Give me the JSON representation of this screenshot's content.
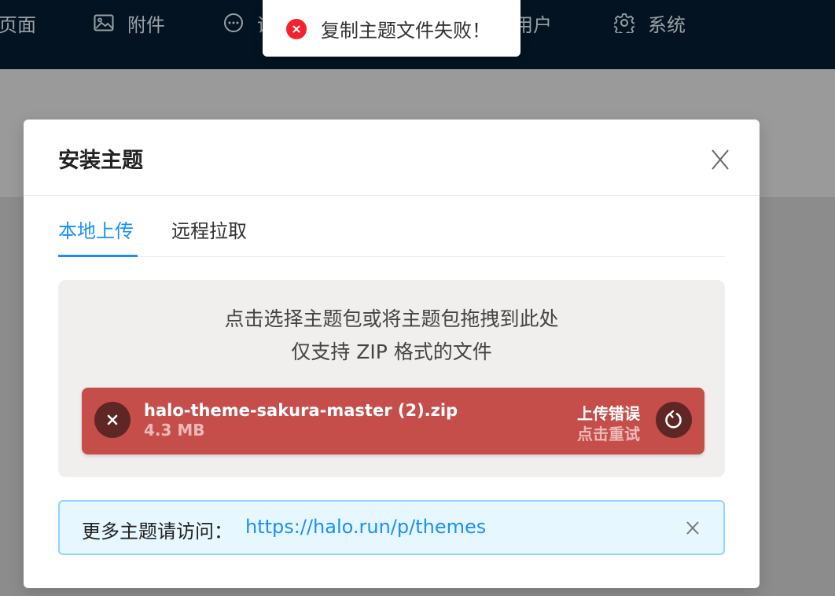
{
  "nav": {
    "items": [
      {
        "label": "页面",
        "icon": "page-icon"
      },
      {
        "label": "附件",
        "icon": "image-icon"
      },
      {
        "label": "评论",
        "icon": "comment-icon"
      },
      {
        "label": "用户",
        "icon": "user-icon"
      },
      {
        "label": "系统",
        "icon": "gear-icon"
      }
    ]
  },
  "toast": {
    "message": "复制主题文件失败！",
    "icon": "error-circle-icon",
    "color": "#f5222d"
  },
  "modal": {
    "title": "安装主题",
    "close_icon": "close-icon",
    "tabs": [
      {
        "label": "本地上传",
        "active": true
      },
      {
        "label": "远程拉取",
        "active": false
      }
    ],
    "dropzone": {
      "line1": "点击选择主题包或将主题包拖拽到此处",
      "line2": "仅支持 ZIP 格式的文件"
    },
    "file": {
      "name": "halo-theme-sakura-master (2).zip",
      "size": "4.3 MB",
      "status": "上传错误",
      "action": "点击重试",
      "color": "#c54e4b"
    },
    "info": {
      "label": "更多主题请访问：",
      "link": "https://halo.run/p/themes"
    }
  },
  "colors": {
    "accent": "#1890ff",
    "nav_bg": "#031321"
  }
}
